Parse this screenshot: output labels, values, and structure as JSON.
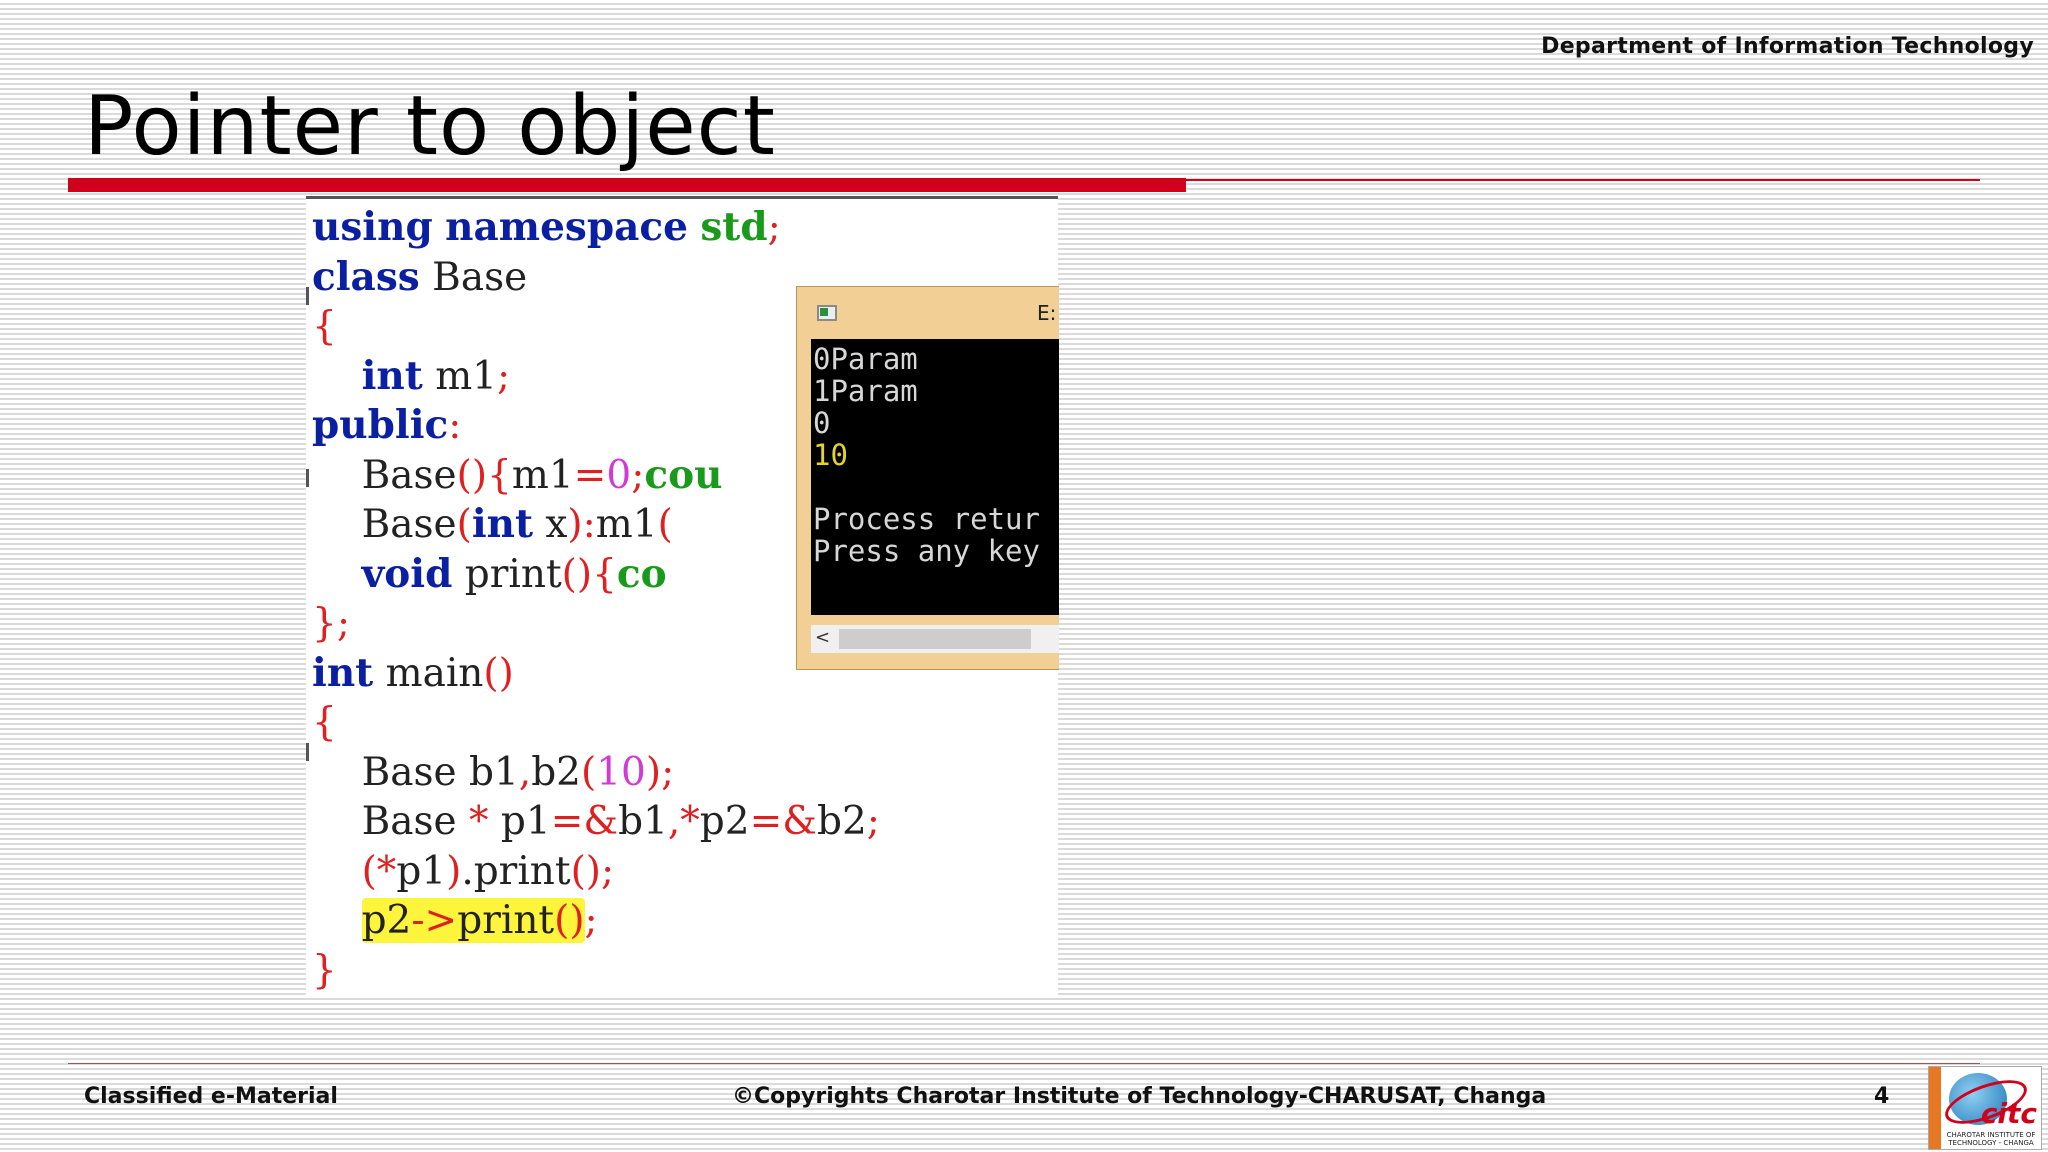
{
  "header": {
    "department": "Department of Information Technology",
    "title": "Pointer to object"
  },
  "code": {
    "line1": [
      "using",
      "namespace",
      "std",
      ";"
    ],
    "line2": [
      "class",
      "Base"
    ],
    "line4": [
      "int",
      "m1",
      ";"
    ],
    "line5": [
      "public",
      ":"
    ],
    "line6": [
      "Base",
      "()",
      "{",
      "m1",
      "=",
      "0",
      ";",
      "cou"
    ],
    "line7": [
      "Base",
      "(",
      "int",
      "x",
      ")",
      ":",
      "m1",
      "("
    ],
    "line8": [
      "void",
      "print",
      "()",
      "{",
      "co"
    ],
    "line10": [
      "int",
      "main",
      "()"
    ],
    "line12": [
      "Base",
      "b1",
      ",",
      "b2",
      "(",
      "10",
      ")",
      ";"
    ],
    "line13": [
      "Base",
      "*",
      "p1",
      "=&",
      "b1",
      ",*",
      "p2",
      "=&",
      "b2",
      ";"
    ],
    "line14": [
      "(*",
      "p1",
      ")",
      ".",
      "print",
      "()",
      ";"
    ],
    "line15": [
      "p2",
      "->",
      "print",
      "()",
      ";"
    ],
    "brace_open": "{",
    "brace_class_close": "}",
    "semicolon": ";",
    "brace_close": "}"
  },
  "console": {
    "title_fragment": "E:",
    "lines": [
      "0Param",
      "1Param",
      "0",
      "10",
      "",
      "Process retur",
      "Press any key"
    ],
    "scroll_left": "<"
  },
  "footer": {
    "left": "Classified e-Material",
    "center": "©Copyrights Charotar Institute of Technology-CHARUSAT, Changa",
    "page": "4"
  },
  "logo": {
    "brand": "citc",
    "tagline": "CHAROTAR INSTITUTE OF TECHNOLOGY - CHANGA"
  },
  "colors": {
    "accent_red": "#d0021b",
    "keyword_blue": "#0b1fa3",
    "std_green": "#1a9a1a",
    "number_magenta": "#d23bd3",
    "highlight_yellow": "#fdf43c"
  }
}
